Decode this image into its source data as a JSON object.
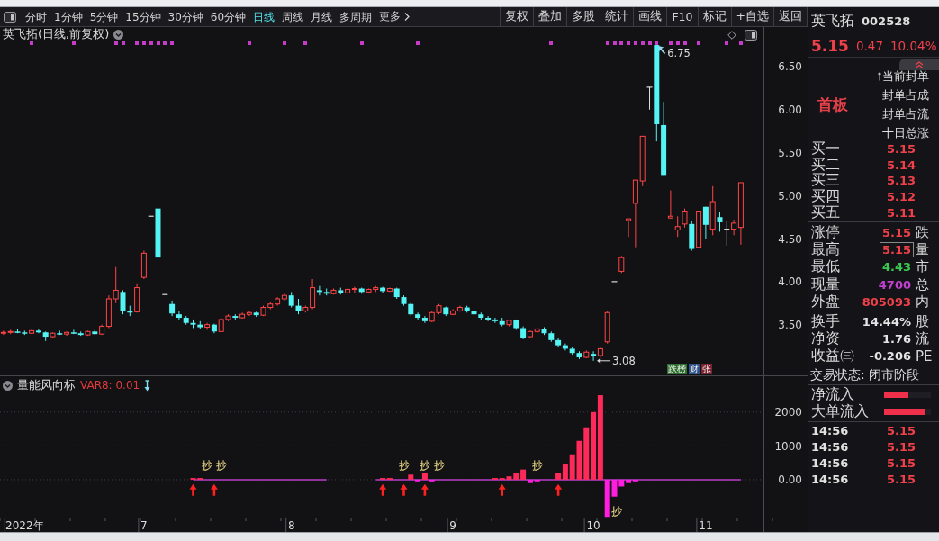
{
  "toolbar": {
    "periods": [
      {
        "label": "分时",
        "selected": false
      },
      {
        "label": "1分钟",
        "selected": false
      },
      {
        "label": "5分钟",
        "selected": false
      },
      {
        "label": "15分钟",
        "selected": false
      },
      {
        "label": "30分钟",
        "selected": false
      },
      {
        "label": "60分钟",
        "selected": false
      },
      {
        "label": "日线",
        "selected": true
      },
      {
        "label": "周线",
        "selected": false
      },
      {
        "label": "月线",
        "selected": false
      },
      {
        "label": "多周期",
        "selected": false
      }
    ],
    "more": "更多",
    "actions": [
      "复权",
      "叠加",
      "多股",
      "统计",
      "画线",
      "F10",
      "标记",
      "+自选",
      "返回"
    ]
  },
  "chart": {
    "title": "英飞拓(日线,前复权)",
    "tags": [
      {
        "label": "跌榜",
        "color": "#2f6f2f"
      },
      {
        "label": "财",
        "color": "#2d4f8a"
      },
      {
        "label": "张",
        "color": "#7a2230"
      }
    ],
    "indicator": {
      "name": "量能风向标",
      "reading": "VAR8: 0.01"
    },
    "chart_data": [
      {
        "type": "candlestick",
        "ylim": [
          2.9,
          6.96
        ],
        "yticks": [
          {
            "value": 3.5,
            "label": "3.50"
          },
          {
            "value": 4,
            "label": "4.00"
          },
          {
            "value": 4.5,
            "label": "4.50"
          },
          {
            "value": 5,
            "label": "5.00"
          },
          {
            "value": 5.5,
            "label": "5.50"
          },
          {
            "value": 6,
            "label": "6.00"
          },
          {
            "value": 6.5,
            "label": "6.50"
          }
        ],
        "annotations": [
          "6.75",
          "3.08"
        ],
        "ohlc": [
          [
            3.4,
            3.43,
            3.38,
            3.41
          ],
          [
            3.41,
            3.44,
            3.39,
            3.42
          ],
          [
            3.42,
            3.45,
            3.4,
            3.41
          ],
          [
            3.41,
            3.43,
            3.38,
            3.4
          ],
          [
            3.4,
            3.44,
            3.39,
            3.43
          ],
          [
            3.43,
            3.45,
            3.4,
            3.41
          ],
          [
            3.41,
            3.42,
            3.31,
            3.36
          ],
          [
            3.36,
            3.41,
            3.35,
            3.4
          ],
          [
            3.4,
            3.43,
            3.38,
            3.39
          ],
          [
            3.39,
            3.42,
            3.37,
            3.41
          ],
          [
            3.41,
            3.44,
            3.39,
            3.4
          ],
          [
            3.4,
            3.42,
            3.37,
            3.38
          ],
          [
            3.38,
            3.43,
            3.37,
            3.42
          ],
          [
            3.42,
            3.44,
            3.38,
            3.39
          ],
          [
            3.39,
            3.5,
            3.38,
            3.48
          ],
          [
            3.48,
            3.84,
            3.46,
            3.8
          ],
          [
            3.8,
            4.17,
            3.75,
            3.9
          ],
          [
            3.88,
            3.9,
            3.62,
            3.66
          ],
          [
            3.66,
            3.72,
            3.6,
            3.64
          ],
          [
            3.65,
            3.98,
            3.64,
            3.93
          ],
          [
            4.05,
            4.36,
            4.03,
            4.33
          ],
          [
            4.76,
            4.76,
            4.76,
            4.76
          ],
          [
            4.85,
            5.15,
            4.28,
            4.28
          ],
          [
            3.85,
            3.85,
            3.85,
            3.85
          ],
          [
            3.74,
            3.78,
            3.6,
            3.63
          ],
          [
            3.62,
            3.66,
            3.55,
            3.58
          ],
          [
            3.58,
            3.6,
            3.5,
            3.52
          ],
          [
            3.52,
            3.56,
            3.46,
            3.5
          ],
          [
            3.5,
            3.54,
            3.45,
            3.47
          ],
          [
            3.47,
            3.52,
            3.44,
            3.5
          ],
          [
            3.5,
            3.51,
            3.4,
            3.42
          ],
          [
            3.42,
            3.58,
            3.41,
            3.56
          ],
          [
            3.56,
            3.62,
            3.54,
            3.6
          ],
          [
            3.6,
            3.62,
            3.56,
            3.58
          ],
          [
            3.58,
            3.64,
            3.57,
            3.62
          ],
          [
            3.62,
            3.66,
            3.6,
            3.64
          ],
          [
            3.64,
            3.65,
            3.59,
            3.61
          ],
          [
            3.61,
            3.72,
            3.6,
            3.7
          ],
          [
            3.7,
            3.76,
            3.68,
            3.74
          ],
          [
            3.74,
            3.82,
            3.72,
            3.8
          ],
          [
            3.8,
            3.86,
            3.78,
            3.84
          ],
          [
            3.84,
            3.88,
            3.7,
            3.72
          ],
          [
            3.72,
            3.8,
            3.62,
            3.66
          ],
          [
            3.66,
            3.72,
            3.64,
            3.7
          ],
          [
            3.7,
            4.03,
            3.68,
            3.93
          ],
          [
            3.9,
            3.95,
            3.84,
            3.88
          ],
          [
            3.88,
            3.92,
            3.84,
            3.86
          ],
          [
            3.86,
            3.92,
            3.85,
            3.9
          ],
          [
            3.9,
            3.93,
            3.85,
            3.87
          ],
          [
            3.87,
            3.92,
            3.86,
            3.91
          ],
          [
            3.91,
            3.94,
            3.87,
            3.92
          ],
          [
            3.92,
            3.93,
            3.86,
            3.88
          ],
          [
            3.88,
            3.92,
            3.87,
            3.91
          ],
          [
            3.91,
            3.95,
            3.88,
            3.93
          ],
          [
            3.93,
            3.94,
            3.87,
            3.89
          ],
          [
            3.89,
            3.93,
            3.88,
            3.92
          ],
          [
            3.92,
            3.93,
            3.8,
            3.82
          ],
          [
            3.82,
            3.84,
            3.72,
            3.74
          ],
          [
            3.74,
            3.76,
            3.6,
            3.62
          ],
          [
            3.62,
            3.64,
            3.56,
            3.58
          ],
          [
            3.58,
            3.6,
            3.52,
            3.54
          ],
          [
            3.54,
            3.66,
            3.53,
            3.64
          ],
          [
            3.64,
            3.74,
            3.62,
            3.72
          ],
          [
            3.7,
            3.71,
            3.6,
            3.62
          ],
          [
            3.62,
            3.68,
            3.61,
            3.66
          ],
          [
            3.66,
            3.72,
            3.65,
            3.7
          ],
          [
            3.7,
            3.72,
            3.64,
            3.66
          ],
          [
            3.66,
            3.67,
            3.6,
            3.62
          ],
          [
            3.62,
            3.64,
            3.56,
            3.58
          ],
          [
            3.58,
            3.6,
            3.54,
            3.56
          ],
          [
            3.56,
            3.58,
            3.52,
            3.54
          ],
          [
            3.54,
            3.58,
            3.48,
            3.5
          ],
          [
            3.5,
            3.56,
            3.48,
            3.55
          ],
          [
            3.55,
            3.56,
            3.44,
            3.46
          ],
          [
            3.46,
            3.48,
            3.33,
            3.35
          ],
          [
            3.36,
            3.43,
            3.35,
            3.42
          ],
          [
            3.42,
            3.46,
            3.4,
            3.45
          ],
          [
            3.45,
            3.47,
            3.38,
            3.4
          ],
          [
            3.4,
            3.42,
            3.3,
            3.32
          ],
          [
            3.32,
            3.34,
            3.24,
            3.26
          ],
          [
            3.26,
            3.28,
            3.2,
            3.22
          ],
          [
            3.22,
            3.24,
            3.15,
            3.17
          ],
          [
            3.17,
            3.19,
            3.1,
            3.12
          ],
          [
            3.12,
            3.2,
            3.11,
            3.18
          ],
          [
            3.16,
            3.19,
            3.08,
            3.14
          ],
          [
            3.14,
            3.24,
            3.12,
            3.22
          ],
          [
            3.3,
            3.66,
            3.28,
            3.64
          ],
          [
            4.0,
            4.0,
            4.0,
            4.0
          ],
          [
            4.12,
            4.3,
            4.1,
            4.28
          ],
          [
            4.71,
            4.73,
            4.52,
            4.73
          ],
          [
            4.91,
            5.18,
            4.4,
            5.18
          ],
          [
            5.17,
            5.69,
            5.11,
            5.69
          ],
          [
            6.26,
            6.26,
            6.0,
            6.26
          ],
          [
            6.75,
            6.75,
            5.63,
            5.83
          ],
          [
            5.82,
            6.09,
            5.24,
            5.24
          ],
          [
            4.74,
            5.06,
            4.73,
            4.76
          ],
          [
            4.6,
            4.76,
            4.52,
            4.64
          ],
          [
            4.67,
            4.85,
            4.63,
            4.82
          ],
          [
            4.67,
            4.71,
            4.36,
            4.38
          ],
          [
            4.4,
            4.82,
            4.4,
            4.82
          ],
          [
            4.87,
            4.87,
            4.5,
            4.66
          ],
          [
            4.61,
            5.11,
            4.54,
            4.93
          ],
          [
            4.75,
            4.81,
            4.58,
            4.69
          ],
          [
            4.61,
            4.7,
            4.42,
            4.61
          ],
          [
            4.61,
            4.72,
            4.54,
            4.68
          ],
          [
            4.63,
            5.15,
            4.43,
            5.15
          ],
          null,
          null,
          null,
          null,
          null,
          null,
          null,
          null,
          null
        ],
        "series": [
          {
            "type": "scatter",
            "marker": "square",
            "color": "#c63cc8",
            "values": [
              null,
              null,
              null,
              null,
              6.77,
              null,
              null,
              null,
              null,
              null,
              6.77,
              null,
              null,
              null,
              null,
              null,
              6.77,
              6.77,
              null,
              6.77,
              6.77,
              6.77,
              6.77,
              6.77,
              6.77,
              null,
              null,
              null,
              null,
              null,
              null,
              null,
              null,
              null,
              null,
              6.77,
              null,
              null,
              null,
              null,
              6.77,
              null,
              null,
              6.77,
              null,
              null,
              null,
              null,
              null,
              null,
              null,
              6.77,
              null,
              null,
              null,
              null,
              null,
              null,
              null,
              6.77,
              null,
              null,
              null,
              null,
              null,
              null,
              null,
              null,
              null,
              null,
              null,
              null,
              null,
              null,
              null,
              null,
              null,
              null,
              6.77,
              null,
              null,
              null,
              null,
              null,
              null,
              null,
              6.77,
              6.77,
              6.77,
              6.77,
              6.77,
              6.77,
              6.77,
              6.77,
              null,
              6.77,
              6.77,
              6.77,
              null,
              6.77,
              null,
              null,
              null,
              6.77,
              null,
              6.77,
              null,
              null,
              null,
              null,
              null,
              null,
              null,
              null,
              null
            ]
          }
        ]
      },
      {
        "type": "bar",
        "ylim": [
          -1120,
          3060
        ],
        "yticks": [
          {
            "value": 0,
            "label": "0.00"
          },
          {
            "value": 1000,
            "label": "1000"
          },
          {
            "value": 2000,
            "label": "2000"
          }
        ],
        "grid": true,
        "categories": [
          null,
          null,
          null,
          "2022年",
          null,
          null,
          null,
          null,
          null,
          null,
          null,
          null,
          null,
          null,
          null,
          null,
          null,
          null,
          null,
          null,
          "7",
          null,
          null,
          null,
          null,
          null,
          null,
          null,
          null,
          null,
          null,
          null,
          null,
          null,
          null,
          null,
          null,
          null,
          null,
          null,
          null,
          "8",
          null,
          null,
          null,
          null,
          null,
          null,
          null,
          null,
          null,
          null,
          null,
          null,
          null,
          null,
          null,
          null,
          null,
          null,
          null,
          null,
          null,
          null,
          "9",
          null,
          null,
          null,
          null,
          null,
          null,
          null,
          null,
          null,
          null,
          null,
          null,
          null,
          null,
          null,
          null,
          null,
          null,
          null,
          "10",
          null,
          null,
          null,
          null,
          null,
          null,
          null,
          null,
          null,
          null,
          null,
          null,
          null,
          null,
          null,
          "11",
          null,
          null,
          null,
          null,
          null,
          null,
          null,
          null,
          null,
          null,
          null,
          null,
          null,
          null
        ],
        "values": [
          null,
          null,
          null,
          null,
          null,
          null,
          null,
          null,
          null,
          null,
          null,
          null,
          null,
          null,
          null,
          null,
          null,
          null,
          null,
          null,
          null,
          null,
          null,
          null,
          null,
          null,
          null,
          50,
          50,
          null,
          null,
          null,
          null,
          null,
          null,
          null,
          null,
          null,
          null,
          null,
          null,
          null,
          null,
          null,
          null,
          null,
          null,
          null,
          null,
          null,
          null,
          null,
          null,
          null,
          50,
          50,
          null,
          null,
          150,
          -50,
          200,
          -50,
          null,
          null,
          null,
          null,
          null,
          null,
          null,
          null,
          50,
          50,
          100,
          200,
          300,
          -100,
          -50,
          null,
          null,
          200,
          450,
          750,
          1150,
          1550,
          2000,
          2500,
          -1100,
          -500,
          -200,
          -100,
          -50,
          null,
          null,
          null,
          null,
          null,
          null,
          null,
          null,
          null,
          null,
          null,
          null,
          null,
          null,
          null,
          null,
          null,
          null,
          null,
          null,
          null,
          null,
          null,
          null
        ],
        "colors": [
          null,
          null,
          null,
          null,
          null,
          null,
          null,
          null,
          null,
          null,
          null,
          null,
          null,
          null,
          null,
          null,
          null,
          null,
          null,
          null,
          null,
          null,
          null,
          null,
          null,
          null,
          null,
          "#ff2a5a",
          "#ff2a5a",
          null,
          null,
          null,
          null,
          null,
          null,
          null,
          null,
          null,
          null,
          null,
          null,
          null,
          null,
          null,
          null,
          null,
          null,
          null,
          null,
          null,
          null,
          null,
          null,
          null,
          "#ff2a5a",
          "#ff2a5a",
          null,
          null,
          "#ff2a5a",
          "#ff1ee0",
          "#ff2a5a",
          "#ff1ee0",
          null,
          null,
          null,
          null,
          null,
          null,
          null,
          null,
          "#ff2a5a",
          "#ff2a5a",
          "#ff2a5a",
          "#ff2a5a",
          "#ff2a5a",
          "#ff1ee0",
          "#ff1ee0",
          null,
          null,
          "#ff2a5a",
          "#ff2a5a",
          "#ff2a5a",
          "#ff2a5a",
          "#ff2a5a",
          "#ff2a5a",
          "#ff2a5a",
          "#ff1ee0",
          "#ff1ee0",
          "#ff1ee0",
          "#ff1ee0",
          "#ff1ee0",
          null,
          null,
          null,
          null,
          null,
          null,
          null,
          null,
          null,
          null,
          null,
          null,
          null,
          null,
          null,
          null,
          null,
          null,
          null,
          null,
          null,
          null,
          null,
          null
        ],
        "value_labels": [
          null,
          null,
          null,
          null,
          null,
          null,
          null,
          null,
          null,
          null,
          null,
          null,
          null,
          null,
          null,
          null,
          null,
          null,
          null,
          null,
          null,
          null,
          null,
          null,
          null,
          null,
          null,
          null,
          null,
          null,
          null,
          null,
          null,
          null,
          null,
          null,
          null,
          null,
          null,
          null,
          null,
          null,
          null,
          null,
          null,
          null,
          null,
          null,
          null,
          null,
          null,
          null,
          null,
          null,
          null,
          null,
          null,
          null,
          null,
          null,
          null,
          null,
          null,
          null,
          null,
          null,
          null,
          null,
          null,
          null,
          null,
          null,
          null,
          null,
          null,
          null,
          null,
          null,
          null,
          null,
          null,
          null,
          null,
          null,
          null,
          null,
          "抄",
          null,
          null,
          null,
          null,
          null,
          null,
          null,
          null,
          null,
          null,
          null,
          null,
          null,
          null,
          null,
          null,
          null,
          null,
          null,
          null,
          null,
          null,
          null,
          null,
          null,
          null,
          null,
          null
        ],
        "series": [
          {
            "type": "line",
            "color": "#b83cc8",
            "values": [
              null,
              null,
              null,
              null,
              null,
              null,
              null,
              null,
              null,
              null,
              null,
              null,
              null,
              null,
              null,
              null,
              null,
              null,
              null,
              null,
              null,
              null,
              null,
              null,
              null,
              null,
              null,
              0,
              0,
              0,
              0,
              0,
              0,
              0,
              0,
              0,
              0,
              0,
              0,
              0,
              0,
              0,
              0,
              0,
              0,
              0,
              0,
              null,
              null,
              null,
              null,
              null,
              null,
              0,
              0,
              0,
              0,
              0,
              0,
              0,
              0,
              0,
              0,
              0,
              0,
              0,
              0,
              0,
              0,
              0,
              0,
              0,
              0,
              0,
              0,
              0,
              0,
              0,
              0,
              0,
              0,
              0,
              0,
              0,
              0,
              0,
              0,
              0,
              0,
              0,
              0,
              0,
              0,
              0,
              0,
              0,
              0,
              0,
              0,
              0,
              0,
              0,
              0,
              0,
              0,
              0,
              null,
              null,
              null,
              null,
              null,
              null,
              null,
              null,
              null
            ],
            "value_labels": [
              null,
              null,
              null,
              null,
              null,
              null,
              null,
              null,
              null,
              null,
              null,
              null,
              null,
              null,
              null,
              null,
              null,
              null,
              null,
              null,
              null,
              null,
              null,
              null,
              null,
              null,
              null,
              null,
              null,
              "抄",
              null,
              "抄",
              null,
              null,
              null,
              null,
              null,
              null,
              null,
              null,
              null,
              null,
              null,
              null,
              null,
              null,
              null,
              null,
              null,
              null,
              null,
              null,
              null,
              null,
              null,
              null,
              null,
              "抄",
              null,
              null,
              "抄",
              null,
              "抄",
              null,
              null,
              null,
              null,
              null,
              null,
              null,
              null,
              null,
              null,
              null,
              null,
              null,
              "抄",
              null,
              null,
              null,
              null,
              null,
              null,
              null,
              null,
              null,
              null,
              null,
              null,
              null,
              null,
              null,
              null,
              null,
              null,
              null,
              null,
              null,
              null,
              null,
              null,
              null,
              null,
              null,
              null,
              null,
              null,
              null,
              null,
              null,
              null,
              null,
              null,
              null,
              null
            ]
          },
          {
            "type": "scatter",
            "marker": "triangle",
            "color": "#ff2020",
            "values": [
              null,
              null,
              null,
              null,
              null,
              null,
              null,
              null,
              null,
              null,
              null,
              null,
              null,
              null,
              null,
              null,
              null,
              null,
              null,
              null,
              null,
              null,
              null,
              null,
              null,
              null,
              null,
              -300,
              null,
              null,
              -300,
              null,
              null,
              null,
              null,
              null,
              null,
              null,
              null,
              null,
              null,
              null,
              null,
              null,
              null,
              null,
              null,
              null,
              null,
              null,
              null,
              null,
              null,
              null,
              -300,
              null,
              null,
              -300,
              null,
              null,
              -300,
              null,
              null,
              null,
              null,
              null,
              null,
              null,
              null,
              null,
              null,
              -300,
              null,
              null,
              null,
              null,
              null,
              null,
              null,
              -300,
              null,
              null,
              null,
              null,
              null,
              null,
              null,
              null,
              null,
              null,
              null,
              null,
              null,
              null,
              null,
              null,
              null,
              null,
              null,
              null,
              null,
              null,
              null,
              null,
              null,
              null,
              null,
              null,
              null,
              null,
              null,
              null,
              null,
              null,
              null
            ]
          }
        ]
      }
    ]
  },
  "quote": {
    "name": "英飞拓",
    "code": "002528",
    "price": "5.15",
    "change": "0.47",
    "change_pct": "10.04%",
    "board": "首板",
    "board_info": [
      "当前封单",
      "封单占成",
      "封单占流",
      "十日总涨"
    ],
    "bids": [
      {
        "label": "买一",
        "price": "5.15"
      },
      {
        "label": "买二",
        "price": "5.14"
      },
      {
        "label": "买三",
        "price": "5.13"
      },
      {
        "label": "买四",
        "price": "5.12"
      },
      {
        "label": "买五",
        "price": "5.11"
      }
    ],
    "stats": [
      {
        "label": "涨停",
        "value": "5.15",
        "side": "跌",
        "color": "#f0404a",
        "selected": false
      },
      {
        "label": "最高",
        "value": "5.15",
        "side": "量",
        "color": "#f0404a",
        "selected": true
      },
      {
        "label": "最低",
        "value": "4.43",
        "side": "市",
        "color": "#3cc850",
        "selected": false
      },
      {
        "label": "现量",
        "value": "4700",
        "side": "总",
        "color": "#c040d0",
        "selected": false
      },
      {
        "label": "外盘",
        "value": "805093",
        "side": "内",
        "color": "#f0404a",
        "selected": false
      }
    ],
    "fundamentals": [
      {
        "label": "换手",
        "value": "14.44%",
        "side": "股"
      },
      {
        "label": "净资",
        "value": "1.76",
        "side": "流"
      },
      {
        "label": "收益㈢",
        "value": "-0.206",
        "side": "PE"
      }
    ],
    "status": "交易状态: 闭市阶段",
    "flows": [
      {
        "label": "净流入",
        "level": 0.52
      },
      {
        "label": "大单流入",
        "level": 0.88
      }
    ],
    "ticks": [
      {
        "time": "14:56",
        "price": "5.15"
      },
      {
        "time": "14:56",
        "price": "5.15"
      },
      {
        "time": "14:56",
        "price": "5.15"
      },
      {
        "time": "14:56",
        "price": "5.15"
      }
    ]
  }
}
